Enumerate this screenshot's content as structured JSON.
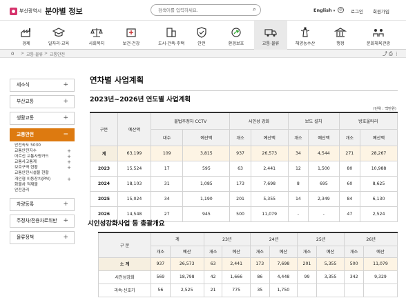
{
  "header": {
    "city": "부산광역시",
    "title": "분야별 정보",
    "search_placeholder": "검색어를 입력하세요.",
    "language": "English",
    "login": "로그인",
    "join": "회원가입"
  },
  "gnb": [
    {
      "label": "경제",
      "icon": "factory-icon"
    },
    {
      "label": "일자리·교육",
      "icon": "graduation-icon"
    },
    {
      "label": "사회복지",
      "icon": "scale-icon"
    },
    {
      "label": "보건·건강",
      "icon": "hospital-icon"
    },
    {
      "label": "도시·건축·주택",
      "icon": "building-icon"
    },
    {
      "label": "안전",
      "icon": "shield-icon"
    },
    {
      "label": "환경보호",
      "icon": "recycle-icon"
    },
    {
      "label": "교통·물류",
      "icon": "truck-icon",
      "active": true
    },
    {
      "label": "해양농수산",
      "icon": "lighthouse-icon"
    },
    {
      "label": "행정",
      "icon": "government-icon"
    },
    {
      "label": "문화체육관광",
      "icon": "people-icon"
    }
  ],
  "breadcrumb": [
    "교통·물류",
    "교통안전"
  ],
  "sidebar": {
    "items_top": [
      "세소식",
      "부산교통",
      "생활교통"
    ],
    "active": "교통안전",
    "sub": [
      {
        "label": "안전속도 5030",
        "plus": false
      },
      {
        "label": "교통안전지수",
        "plus": true
      },
      {
        "label": "어르신 교통사랑카드",
        "plus": true
      },
      {
        "label": "교통사고통계",
        "plus": true
      },
      {
        "label": "보호구역 현황",
        "plus": true
      },
      {
        "label": "교통안전시설물 현황",
        "plus": false
      },
      {
        "label": "개인형 이동장치(PM)",
        "plus": true
      },
      {
        "label": "화물차 적재물",
        "plus": false
      },
      {
        "label": "안전관리",
        "plus": false
      }
    ],
    "items_bottom": [
      "차량등록",
      "주정차/전용차로위반",
      "물류정책"
    ]
  },
  "content": {
    "page_title": "연차별 사업계획",
    "sub_title": "2023년~2026년 연도별 사업계획",
    "unit": "(단위 : 백만원)",
    "table1": {
      "h_category": "구분",
      "h_budget": "예산액",
      "groups": [
        "불법주정차 CCTV",
        "시인성 강화",
        "보도 설치",
        "방호울타리"
      ],
      "sub_headers": [
        "대수",
        "예산액",
        "개소",
        "예산액",
        "개소",
        "예산액",
        "개소",
        "예산액"
      ],
      "rows": [
        [
          "계",
          "63,199",
          "109",
          "3,815",
          "937",
          "26,573",
          "34",
          "4,544",
          "271",
          "28,267"
        ],
        [
          "2023",
          "15,524",
          "17",
          "595",
          "63",
          "2,441",
          "12",
          "1,500",
          "80",
          "10,988"
        ],
        [
          "2024",
          "18,103",
          "31",
          "1,085",
          "173",
          "7,698",
          "8",
          "695",
          "60",
          "8,625"
        ],
        [
          "2025",
          "15,024",
          "34",
          "1,190",
          "201",
          "5,355",
          "14",
          "2,349",
          "84",
          "6,130"
        ],
        [
          "2026",
          "14,548",
          "27",
          "945",
          "500",
          "11,079",
          "-",
          "-",
          "47",
          "2,524"
        ]
      ]
    },
    "section2_title": "시인성강화사업 등 총괄개요",
    "table2": {
      "h_category": "구 분",
      "groups": [
        "계",
        "23년",
        "24년",
        "25년",
        "26년"
      ],
      "sub_headers": [
        "개소",
        "예산",
        "개소",
        "예산",
        "개소",
        "예산",
        "개소",
        "예산",
        "개소",
        "예산"
      ],
      "rows": [
        [
          "소 계",
          "937",
          "26,573",
          "63",
          "2,441",
          "173",
          "7,698",
          "201",
          "5,355",
          "500",
          "11,079"
        ],
        [
          "시인성강화",
          "569",
          "18,798",
          "42",
          "1,666",
          "86",
          "4,448",
          "99",
          "3,355",
          "342",
          "9,329"
        ],
        [
          "과속·신호기",
          "56",
          "2,525",
          "21",
          "775",
          "35",
          "1,750",
          "",
          "",
          "",
          ""
        ]
      ]
    }
  }
}
